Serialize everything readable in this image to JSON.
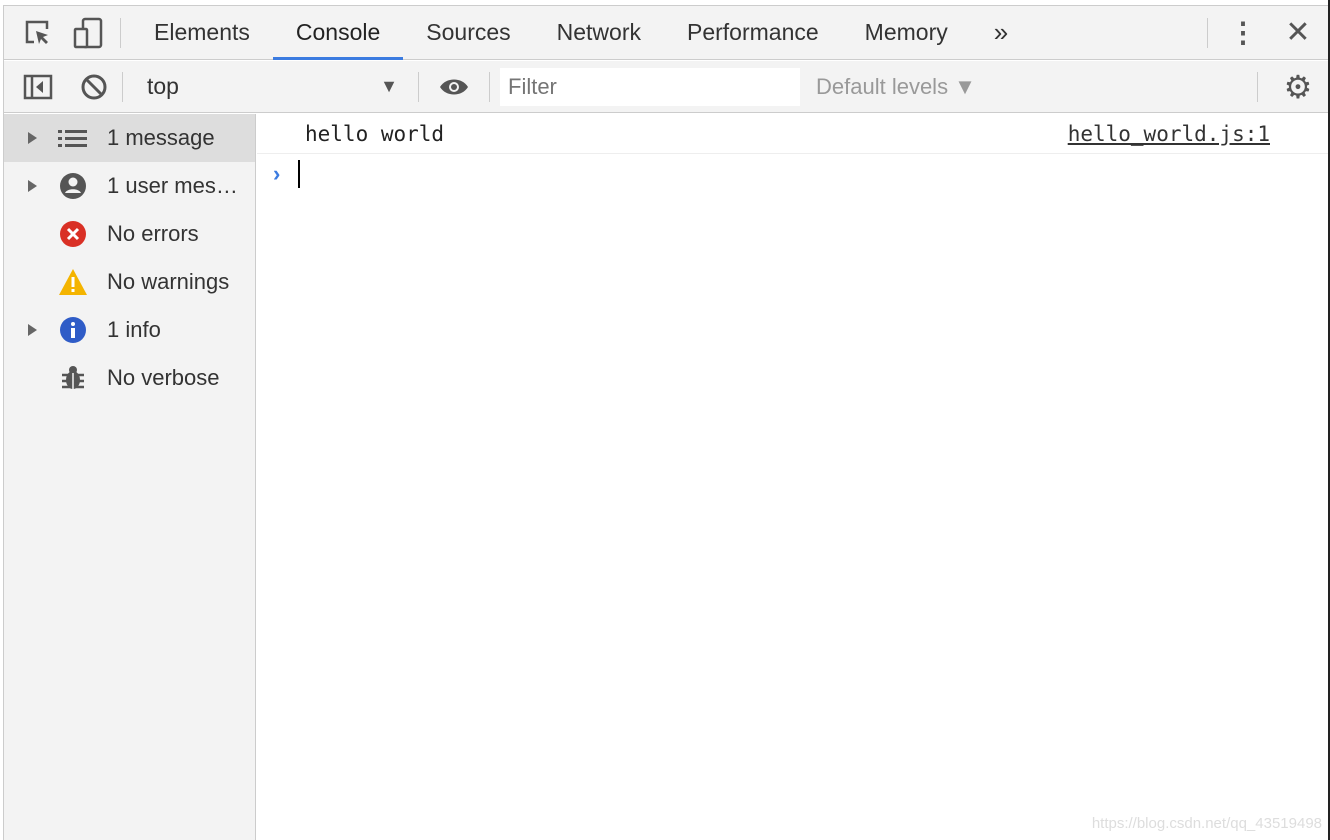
{
  "tabs": [
    "Elements",
    "Console",
    "Sources",
    "Network",
    "Performance",
    "Memory"
  ],
  "active_tab": "Console",
  "toolbar": {
    "context": "top",
    "filter_placeholder": "Filter",
    "levels": "Default levels ▼"
  },
  "sidebar": {
    "items": [
      {
        "label": "1 message",
        "icon": "list-icon",
        "expandable": true,
        "selected": true
      },
      {
        "label": "1 user mes…",
        "icon": "user-icon",
        "expandable": true
      },
      {
        "label": "No errors",
        "icon": "error-icon"
      },
      {
        "label": "No warnings",
        "icon": "warning-icon"
      },
      {
        "label": "1 info",
        "icon": "info-icon",
        "expandable": true
      },
      {
        "label": "No verbose",
        "icon": "bug-icon"
      }
    ]
  },
  "console": {
    "message": "hello world",
    "source": "hello_world.js:1"
  },
  "watermark": "https://blog.csdn.net/qq_43519498",
  "colors": {
    "accent": "#3b7be0",
    "error": "#d93025",
    "warning": "#f4b400",
    "info": "#2f5cc7"
  }
}
